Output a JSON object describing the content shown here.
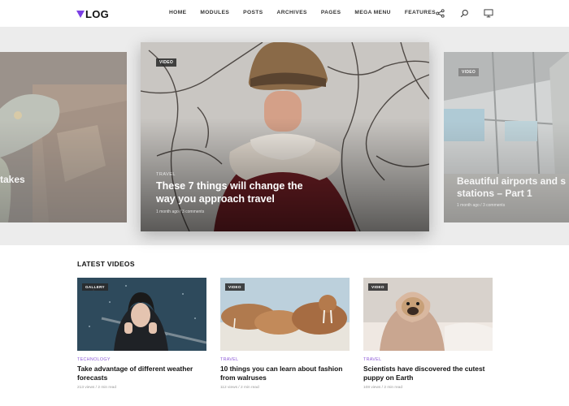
{
  "header": {
    "logo_text": "LOG",
    "nav": [
      "HOME",
      "MODULES",
      "POSTS",
      "ARCHIVES",
      "PAGES",
      "MEGA MENU",
      "FEATURES"
    ]
  },
  "icons": [
    "share-icon",
    "search-icon",
    "monitor-icon"
  ],
  "slider": {
    "left": {
      "title_fragment": "takes"
    },
    "main": {
      "badge": "VIDEO",
      "category": "TRAVEL",
      "title_line1": "These 7 things will change the",
      "title_line2": "way you approach travel",
      "meta": "1 month ago  /  3 comments"
    },
    "right": {
      "badge": "VIDEO",
      "title_line1": "Beautiful airports and s",
      "title_line2": "stations – Part 1",
      "meta": "1 month ago  /  3 comments"
    }
  },
  "latest": {
    "title": "LATEST VIDEOS",
    "cards": [
      {
        "badge": "GALLERY",
        "category": "TECHNOLOGY",
        "title": "Take advantage of different weather forecasts",
        "meta": "213 views  /  2 min read"
      },
      {
        "badge": "VIDEO",
        "category": "TRAVEL",
        "title": "10 things you can learn about fashion from walruses",
        "meta": "112 views  /  2 min read"
      },
      {
        "badge": "VIDEO",
        "category": "TRAVEL",
        "title": "Scientists have discovered the cutest puppy on Earth",
        "meta": "108 views  /  2 min read"
      }
    ]
  },
  "colors": {
    "accent": "#7b3fe4",
    "category": "#8e5bd8"
  }
}
